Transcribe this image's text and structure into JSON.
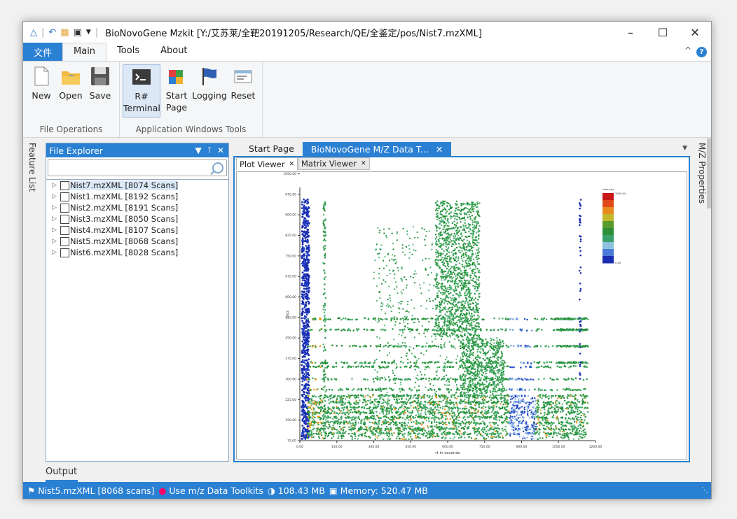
{
  "window": {
    "title": "BioNovoGene Mzkit [Y:/艾苏莱/全靶20191205/Research/QE/全鉴定/pos/Nist7.mzXML]",
    "controls": [
      "–",
      "☐",
      "✕"
    ]
  },
  "ribbon": {
    "tabs": [
      {
        "label": "文件"
      },
      {
        "label": "Main"
      },
      {
        "label": "Tools"
      },
      {
        "label": "About"
      }
    ],
    "groups": [
      {
        "label": "File Operations",
        "buttons": [
          {
            "label": "New"
          },
          {
            "label": "Open"
          },
          {
            "label": "Save"
          }
        ]
      },
      {
        "label": "Application Windows Tools",
        "buttons": [
          {
            "label": "R#\nTerminal"
          },
          {
            "label": "Start\nPage"
          },
          {
            "label": "Logging"
          },
          {
            "label": "Reset"
          }
        ]
      }
    ],
    "help": "?"
  },
  "left_strip": {
    "label": "Feature List"
  },
  "right_strip": {
    "label": "M/Z Properties"
  },
  "file_explorer": {
    "title": "File Explorer",
    "search_value": "",
    "items": [
      {
        "label": "Nist7.mzXML [8074 Scans]",
        "selected": true
      },
      {
        "label": "Nist1.mzXML [8192 Scans]",
        "selected": false
      },
      {
        "label": "Nist2.mzXML [8191 Scans]",
        "selected": false
      },
      {
        "label": "Nist3.mzXML [8050 Scans]",
        "selected": false
      },
      {
        "label": "Nist4.mzXML [8107 Scans]",
        "selected": false
      },
      {
        "label": "Nist5.mzXML [8068 Scans]",
        "selected": false
      },
      {
        "label": "Nist6.mzXML [8028 Scans]",
        "selected": false
      }
    ]
  },
  "document": {
    "tabs": [
      {
        "label": "Start Page"
      },
      {
        "label": "BioNovoGene M/Z Data T..."
      }
    ],
    "subtabs": [
      {
        "label": "Plot Viewer"
      },
      {
        "label": "Matrix Viewer"
      }
    ]
  },
  "output": {
    "label": "Output"
  },
  "status_bar": {
    "file": "Nist5.mzXML [8068 scans]",
    "toolkit": "Use m/z Data Toolkits",
    "size": "108.43 MB",
    "memory": "Memory: 520.47 MB"
  },
  "colors": {
    "accent": "#2a80d2"
  },
  "chart_data": {
    "type": "scatter",
    "xlabel": "rt in seconds",
    "ylabel": "m/z",
    "xlim": [
      0,
      1200
    ],
    "ylim": [
      75,
      1000
    ],
    "x_ticks": [
      "0.00",
      "150.00",
      "300.00",
      "450.00",
      "600.00",
      "750.00",
      "900.00",
      "1050.00",
      "1200.00"
    ],
    "y_ticks": [
      "75.00",
      "150.00",
      "225.00",
      "300.00",
      "375.00",
      "450.00",
      "525.00",
      "600.00",
      "675.00",
      "750.00",
      "825.00",
      "900.00",
      "975.00",
      "1050.00"
    ],
    "legend": {
      "max": "1000.00",
      "min": "0.00",
      "title": "intensity",
      "placement": "top-right"
    },
    "grid": false
  }
}
